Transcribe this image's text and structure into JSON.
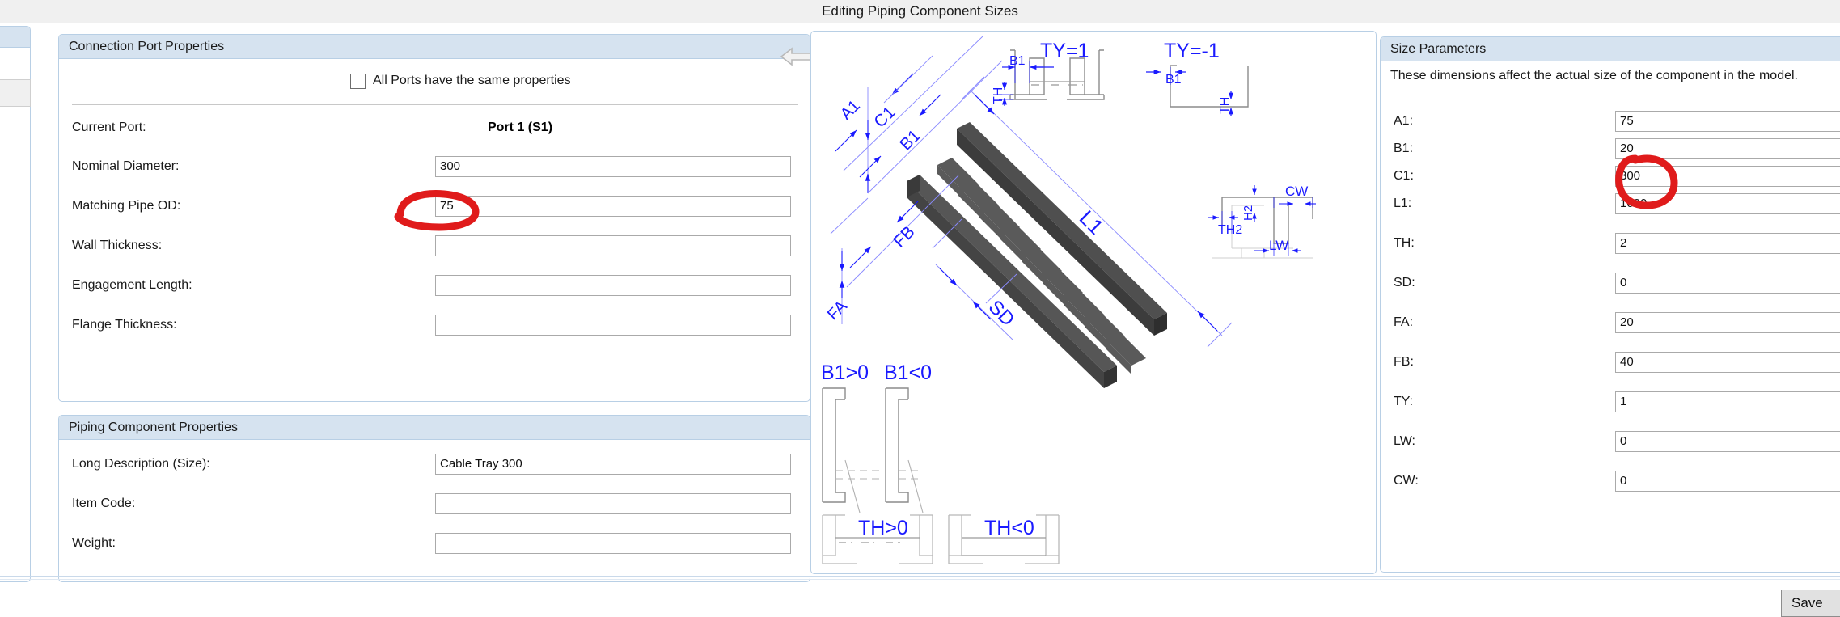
{
  "window": {
    "title": "Editing Piping Component Sizes"
  },
  "connection_port_properties": {
    "header": "Connection Port Properties",
    "all_ports_checkbox": {
      "label": "All Ports have the same properties",
      "checked": false
    },
    "current_port": {
      "label": "Current Port:",
      "value": "Port 1 (S1)"
    },
    "nav": {
      "prev_icon": "arrow-left-icon",
      "next_icon": "arrow-right-icon",
      "prev_enabled": false,
      "next_enabled": true
    },
    "fields": [
      {
        "label": "Nominal Diameter:",
        "value": "300"
      },
      {
        "label": "Matching Pipe OD:",
        "value": "75"
      },
      {
        "label": "Wall Thickness:",
        "value": ""
      },
      {
        "label": "Engagement Length:",
        "value": ""
      },
      {
        "label": "Flange Thickness:",
        "value": ""
      }
    ]
  },
  "piping_component_properties": {
    "header": "Piping Component Properties",
    "fields": [
      {
        "label": "Long Description (Size):",
        "value": "Cable Tray 300"
      },
      {
        "label": "Item Code:",
        "value": ""
      },
      {
        "label": "Weight:",
        "value": ""
      }
    ]
  },
  "size_parameters": {
    "header": "Size Parameters",
    "intro": "These dimensions affect the actual size of the component in the model.",
    "fields": [
      {
        "label": "A1:",
        "value": "75"
      },
      {
        "label": "B1:",
        "value": "20"
      },
      {
        "label": "C1:",
        "value": "300"
      },
      {
        "label": "L1:",
        "value": "1000"
      },
      {
        "label": "TH:",
        "value": "2"
      },
      {
        "label": "SD:",
        "value": "0"
      },
      {
        "label": "FA:",
        "value": "20"
      },
      {
        "label": "FB:",
        "value": "40"
      },
      {
        "label": "TY:",
        "value": "1"
      },
      {
        "label": "LW:",
        "value": "0"
      },
      {
        "label": "CW:",
        "value": "0"
      }
    ]
  },
  "diagram": {
    "description": "Cable tray ladder isometric with dimension callouts",
    "dimension_labels": [
      "A1",
      "C1",
      "B1",
      "FA",
      "FB",
      "L1",
      "SD",
      "TH",
      "TH2",
      "H2",
      "LW",
      "CW"
    ],
    "variant_labels": [
      "TY=1",
      "TY=-1",
      "B1>0",
      "B1<0",
      "TH>0",
      "TH<0"
    ],
    "line_color": "#1a1aff",
    "body_color": "#4a4a4a"
  },
  "footer": {
    "save_label": "Save"
  },
  "annotations": {
    "color": "#e01b1b",
    "marks": [
      {
        "name": "matching-pipe-od-circle",
        "target": "Matching Pipe OD field"
      },
      {
        "name": "a1-circle",
        "target": "A1 field"
      }
    ]
  }
}
